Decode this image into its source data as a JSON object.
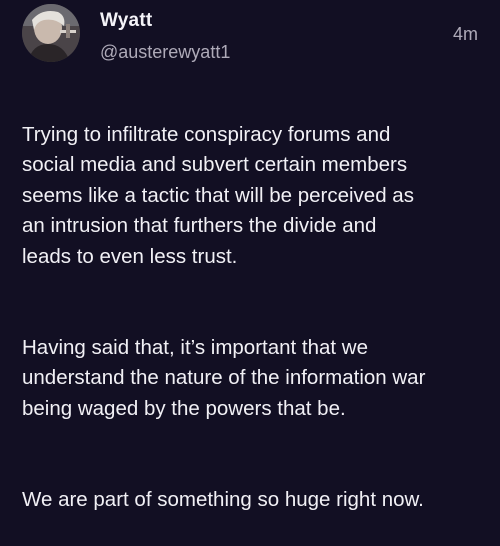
{
  "post": {
    "author_name": "Wyatt",
    "author_handle": "@austerewyatt1",
    "timestamp": "4m",
    "avatar_icon": "profile-photo",
    "paragraphs": [
      "Trying to infiltrate conspiracy forums and\nsocial media and subvert certain members\nseems like a tactic that will be perceived as\nan intrusion that furthers the divide and\nleads to even less trust.",
      "Having said that, it’s important that we\nunderstand the nature of the information war\nbeing waged by the powers that be.",
      "We are part of something so huge right now."
    ]
  },
  "colors": {
    "background": "#120f23",
    "text_primary": "#f1f0f5",
    "text_secondary": "#aeaab8"
  }
}
